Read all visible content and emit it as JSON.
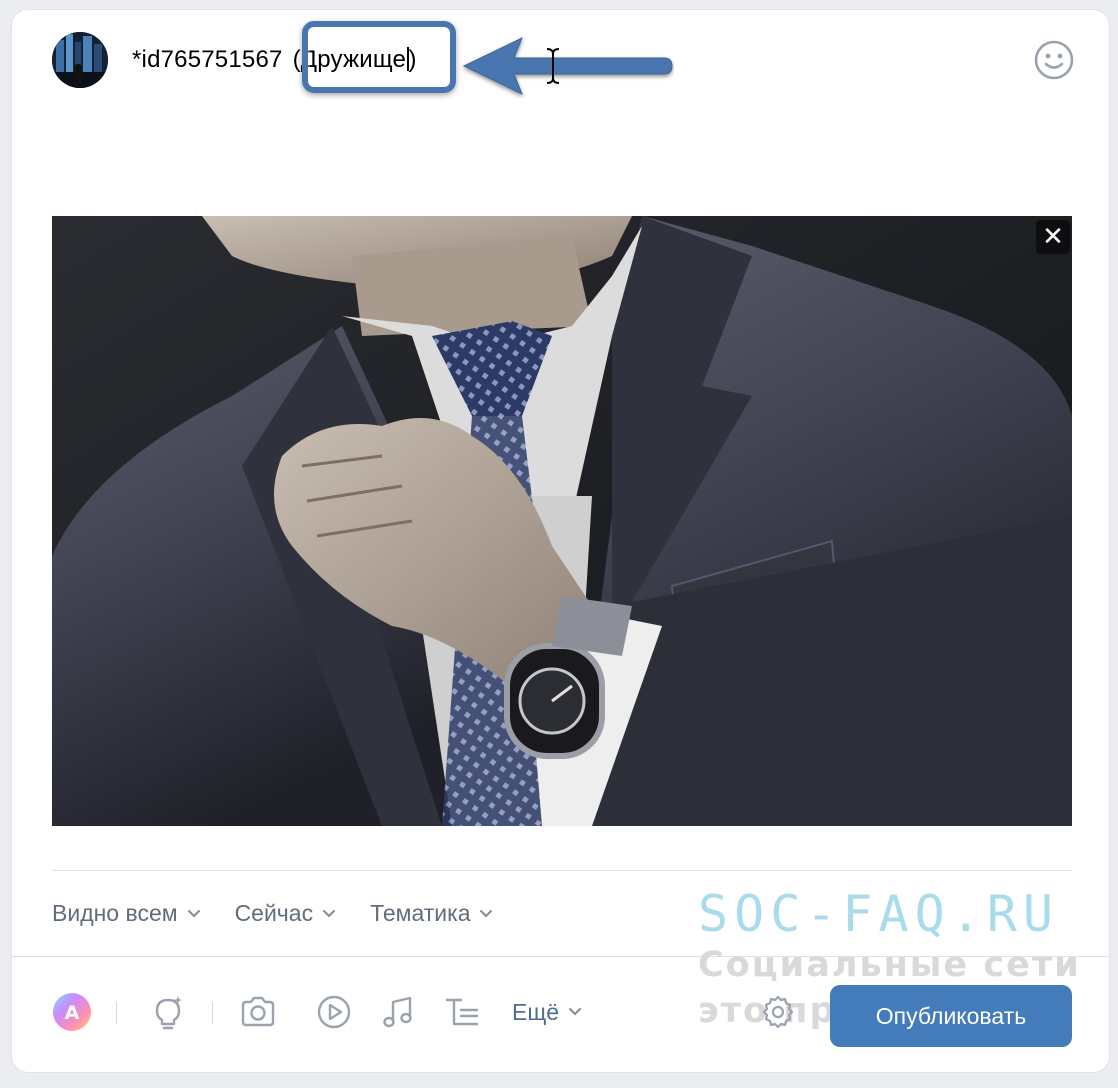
{
  "composer": {
    "mention_id": "*id765751567",
    "mention_name": "(Дружище",
    "mention_close": ")"
  },
  "photo": {
    "close_glyph": "✕"
  },
  "options": {
    "visibility_label": "Видно всем",
    "time_label": "Сейчас",
    "topic_label": "Тематика"
  },
  "toolbar": {
    "more_label": "Ещё",
    "icons": [
      "text-color-icon",
      "idea-icon",
      "camera-icon",
      "video-icon",
      "music-icon",
      "text-format-icon",
      "settings-icon"
    ],
    "publish_label": "Опубликовать"
  },
  "watermark": {
    "title": "SOC-FAQ.RU",
    "subtitle": "Социальные сети это просто!"
  },
  "colors": {
    "accent": "#447bba",
    "annotation": "#4a76b0",
    "secondary_text": "#626d7a",
    "link": "#4f6c93"
  }
}
